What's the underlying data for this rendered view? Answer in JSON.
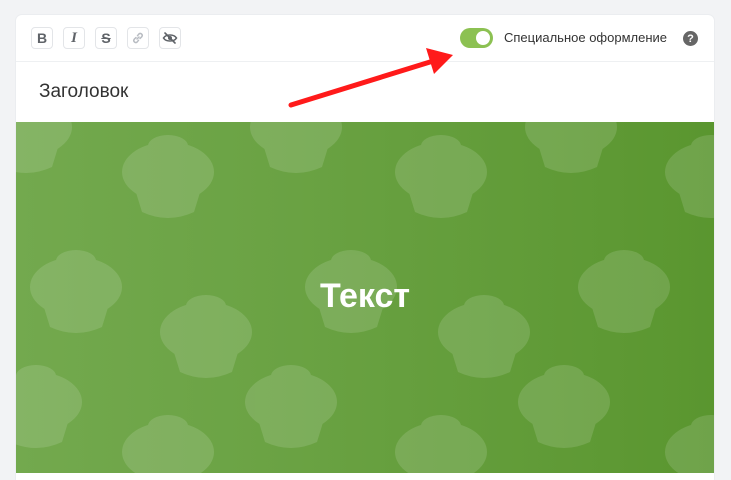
{
  "toolbar": {
    "buttons": [
      {
        "label": "B",
        "icon": "bold-icon"
      },
      {
        "label": "I",
        "icon": "italic-icon"
      },
      {
        "label": "S",
        "icon": "strikethrough-icon"
      },
      {
        "label": "",
        "icon": "link-icon"
      },
      {
        "label": "",
        "icon": "hide-eye-icon"
      }
    ],
    "toggle_label": "Специальное оформление",
    "toggle_on": true,
    "help_symbol": "?"
  },
  "editor": {
    "title_placeholder": "Заголовок",
    "banner_text": "Текст"
  },
  "colors": {
    "accent_green": "#8cc152",
    "banner_green": "#6aa243",
    "arrow_red": "#ff1a1a"
  }
}
